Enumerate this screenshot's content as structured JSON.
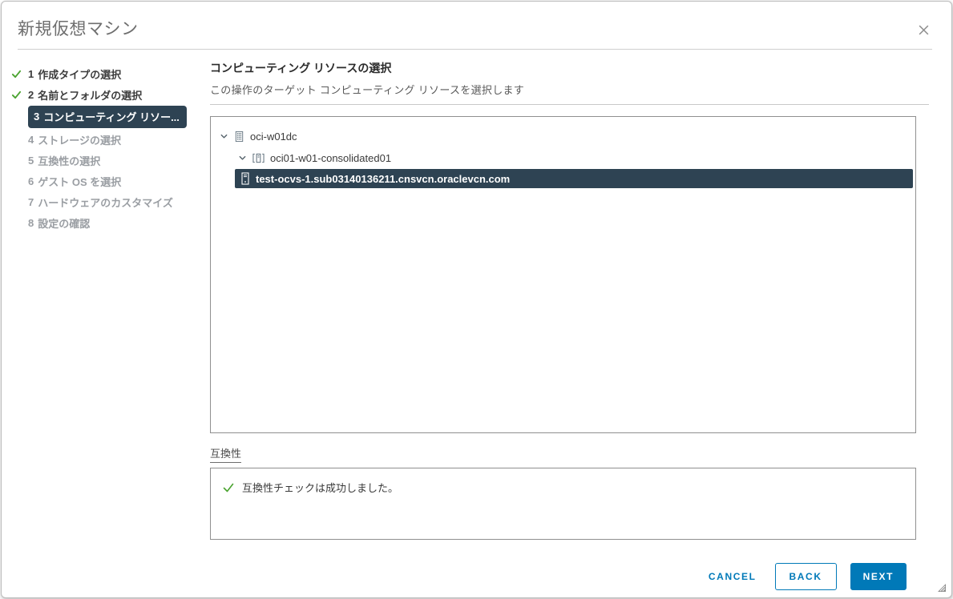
{
  "dialog": {
    "title": "新規仮想マシン"
  },
  "steps": [
    {
      "num": "1",
      "label": "作成タイプの選択",
      "state": "done"
    },
    {
      "num": "2",
      "label": "名前とフォルダの選択",
      "state": "done"
    },
    {
      "num": "3",
      "label": "コンピューティング リソー...",
      "state": "active"
    },
    {
      "num": "4",
      "label": "ストレージの選択",
      "state": "todo"
    },
    {
      "num": "5",
      "label": "互換性の選択",
      "state": "todo"
    },
    {
      "num": "6",
      "label": "ゲスト OS を選択",
      "state": "todo"
    },
    {
      "num": "7",
      "label": "ハードウェアのカスタマイズ",
      "state": "todo"
    },
    {
      "num": "8",
      "label": "設定の確認",
      "state": "todo"
    }
  ],
  "main": {
    "heading": "コンピューティング リソースの選択",
    "subheading": "この操作のターゲット コンピューティング リソースを選択します",
    "tree": [
      {
        "label": "oci-w01dc",
        "icon": "datacenter-icon",
        "level": 0,
        "expanded": true,
        "selected": false
      },
      {
        "label": "oci01-w01-consolidated01",
        "icon": "cluster-icon",
        "level": 1,
        "expanded": true,
        "selected": false
      },
      {
        "label": "test-ocvs-1.sub03140136211.cnsvcn.oraclevcn.com",
        "icon": "host-icon",
        "level": 2,
        "expanded": false,
        "selected": true
      }
    ],
    "compatibility": {
      "label": "互換性",
      "message": "互換性チェックは成功しました。"
    }
  },
  "footer": {
    "cancel": "CANCEL",
    "back": "BACK",
    "next": "NEXT"
  },
  "icons": {
    "close": "✕",
    "chevron_down": "∨",
    "check": "✓",
    "success_check": "✓"
  },
  "colors": {
    "accent_blue": "#0079b8",
    "selection_dark": "#2e4353",
    "success_green": "#4aa32f",
    "muted_step": "#9a9ea3",
    "title_gray": "#6e6e6e"
  }
}
